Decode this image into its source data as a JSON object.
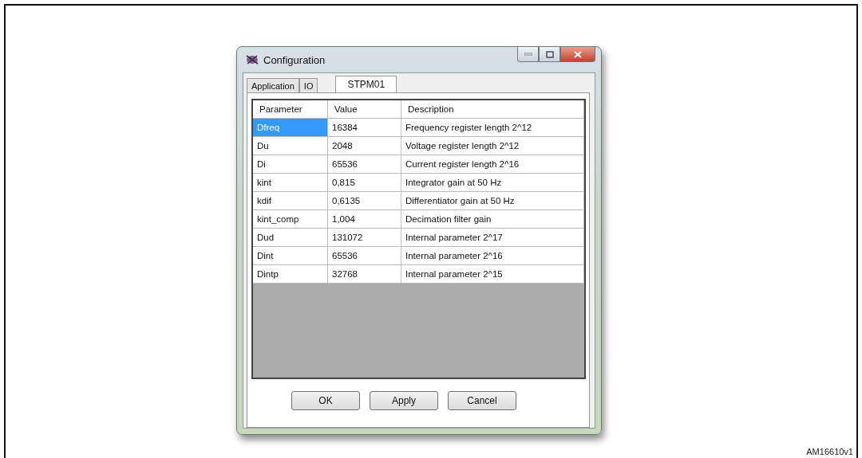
{
  "window": {
    "title": "Configuration"
  },
  "tabs": [
    {
      "label": "Application",
      "selected": false
    },
    {
      "label": "IO",
      "selected": false
    },
    {
      "label": "STPM01",
      "selected": true
    }
  ],
  "table": {
    "columns": [
      "Parameter",
      "Value",
      "Description"
    ],
    "rows": [
      {
        "cells": [
          "Dfreq",
          "16384",
          "Frequency register length 2^12"
        ],
        "selected": true
      },
      {
        "cells": [
          "Du",
          "2048",
          "Voltage register length 2^12"
        ],
        "selected": false
      },
      {
        "cells": [
          "Di",
          "65536",
          "Current register length 2^16"
        ],
        "selected": false
      },
      {
        "cells": [
          "kint",
          "0,815",
          "Integrator gain at 50 Hz"
        ],
        "selected": false
      },
      {
        "cells": [
          "kdif",
          "0,6135",
          "Differentiator gain at 50 Hz"
        ],
        "selected": false
      },
      {
        "cells": [
          "kint_comp",
          "1,004",
          "Decimation filter gain"
        ],
        "selected": false
      },
      {
        "cells": [
          "Dud",
          "131072",
          "Internal parameter 2^17"
        ],
        "selected": false
      },
      {
        "cells": [
          "Dint",
          "65536",
          "Internal parameter 2^16"
        ],
        "selected": false
      },
      {
        "cells": [
          "Dintp",
          "32768",
          "Internal parameter 2^15"
        ],
        "selected": false
      }
    ]
  },
  "buttons": [
    "OK",
    "Apply",
    "Cancel"
  ],
  "figure_id": "AM16610v1"
}
